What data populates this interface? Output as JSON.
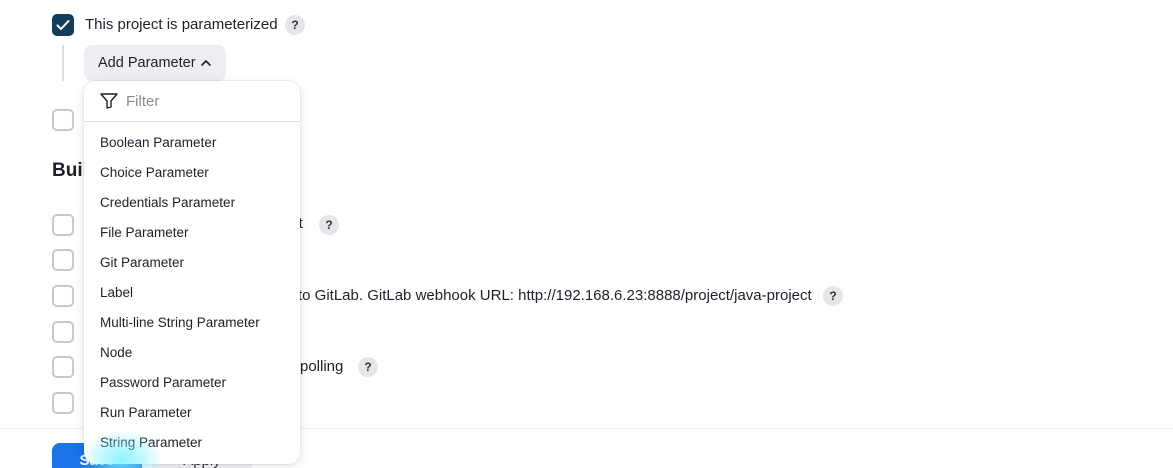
{
  "parameterized": {
    "checked": true,
    "label": "This project is parameterized",
    "help": "?"
  },
  "add_parameter": {
    "label": "Add Parameter"
  },
  "dropdown": {
    "filter_placeholder": "Filter",
    "items": [
      "Boolean Parameter",
      "Choice Parameter",
      "Credentials Parameter",
      "File Parameter",
      "Git Parameter",
      "Label",
      "Multi-line String Parameter",
      "Node",
      "Password Parameter",
      "Run Parameter",
      "String Parameter"
    ]
  },
  "build_triggers": {
    "title_partial": "Buil",
    "rows": [
      {
        "label_partial": "ilt",
        "help": "?"
      },
      {
        "label_partial": ""
      },
      {
        "label_partial": "to GitLab. GitLab webhook URL: http://192.168.6.23:8888/project/java-project",
        "help": "?"
      },
      {
        "label_partial": ""
      },
      {
        "label_partial": "polling",
        "help": "?"
      },
      {
        "label_partial": ""
      }
    ]
  },
  "footer": {
    "save_label": "Save",
    "apply_label": "Apply"
  },
  "colors": {
    "checkbox_checked": "#123e5c",
    "save_button": "#1a73e8"
  }
}
